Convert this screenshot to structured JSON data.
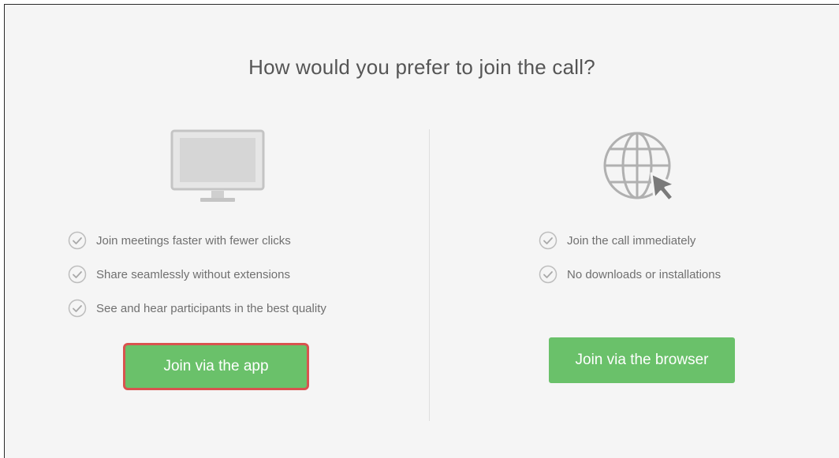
{
  "title": "How would you prefer to join the call?",
  "app_option": {
    "icon": "monitor-icon",
    "features": [
      "Join meetings faster with fewer clicks",
      "Share seamlessly without extensions",
      "See and hear participants in the best quality"
    ],
    "button_label": "Join via the app",
    "highlight_color": "#d9534f"
  },
  "browser_option": {
    "icon": "globe-cursor-icon",
    "features": [
      "Join the call immediately",
      "No downloads or installations"
    ],
    "button_label": "Join via the browser"
  },
  "colors": {
    "button": "#6ac16a",
    "background": "#f5f5f5",
    "text": "#707070"
  }
}
